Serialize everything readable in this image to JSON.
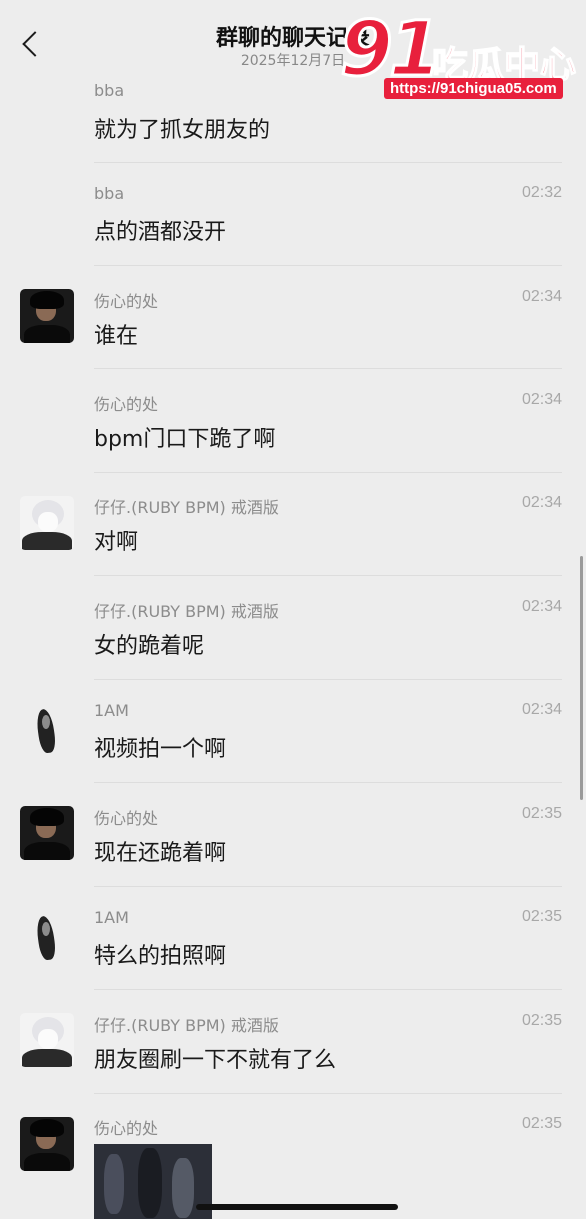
{
  "header": {
    "back_label": "",
    "title": "群聊的聊天记录",
    "subtitle": "2025年12月7日"
  },
  "watermark": {
    "number": "91",
    "brand": "吃瓜中心",
    "url": "https://91chigua05.com",
    "color": "#e8203c"
  },
  "messages": [
    {
      "sender": "bba",
      "time": "",
      "text": "就为了抓女朋友的",
      "avatar": "none"
    },
    {
      "sender": "bba",
      "time": "02:32",
      "text": "点的酒都没开",
      "avatar": "none"
    },
    {
      "sender": "伤心的处",
      "time": "02:34",
      "text": "谁在",
      "avatar": "dark-hair-boy"
    },
    {
      "sender": "伤心的处",
      "time": "02:34",
      "text": "bpm门口下跪了啊",
      "avatar": "none"
    },
    {
      "sender": "仔仔.(RUBY BPM) 戒酒版",
      "time": "02:34",
      "text": "对啊",
      "avatar": "white-hair-boy"
    },
    {
      "sender": "仔仔.(RUBY BPM) 戒酒版",
      "time": "02:34",
      "text": "女的跪着呢",
      "avatar": "none"
    },
    {
      "sender": "1AM",
      "time": "02:34",
      "text": "视频拍一个啊",
      "avatar": "ghost-figure"
    },
    {
      "sender": "伤心的处",
      "time": "02:35",
      "text": "现在还跪着啊",
      "avatar": "dark-hair-boy"
    },
    {
      "sender": "1AM",
      "time": "02:35",
      "text": "特么的拍照啊",
      "avatar": "ghost-figure"
    },
    {
      "sender": "仔仔.(RUBY BPM) 戒酒版",
      "time": "02:35",
      "text": "朋友圈刷一下不就有了么",
      "avatar": "white-hair-boy"
    },
    {
      "sender": "伤心的处",
      "time": "02:35",
      "text": "",
      "avatar": "dark-hair-boy",
      "attachment": "photo"
    }
  ]
}
